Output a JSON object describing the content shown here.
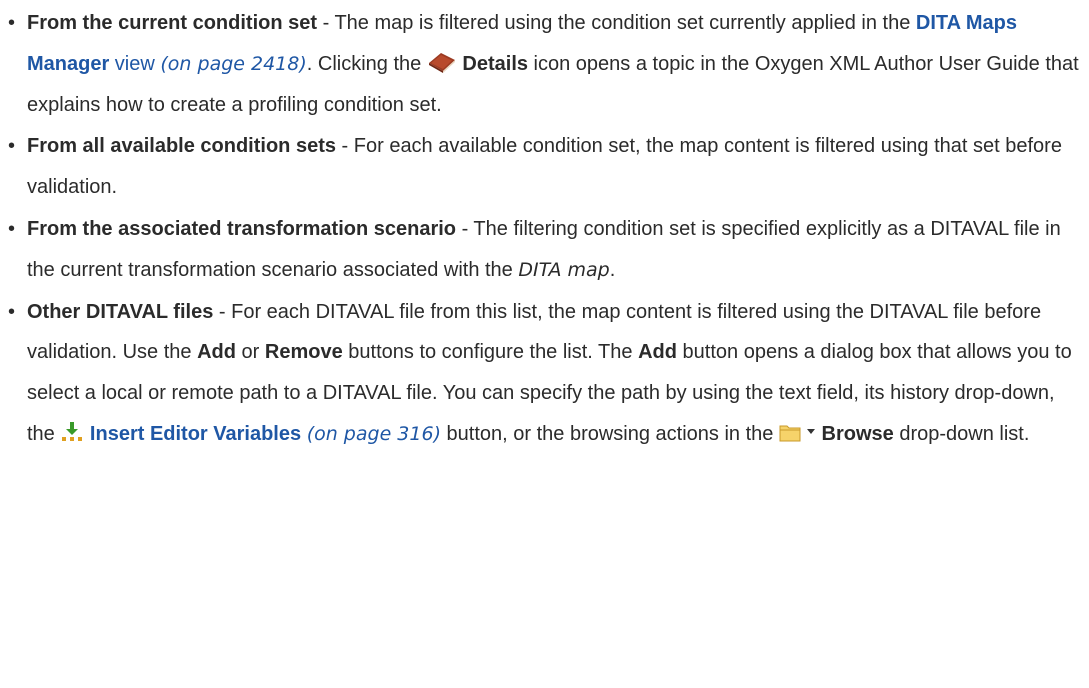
{
  "items": [
    {
      "term": "From the current condition set",
      "t1": " - The map is filtered using the condition set currently applied in the ",
      "link": "DITA Maps Manager",
      "t2": " view",
      "ref": "(on page 2418)",
      "t3": ". Clicking the ",
      "icon": "book-icon",
      "bold": "Details",
      "t4": " icon opens a topic in the Oxygen XML Author User Guide that explains how to create a profiling condition set."
    },
    {
      "term": "From all available condition sets",
      "t1": " - For each available condition set, the map content is filtered using that set before validation."
    },
    {
      "term": "From the associated transformation scenario",
      "t1": " - The filtering condition set is specified explicitly as a DITAVAL file in the current transformation scenario associated with the ",
      "italic": "DITA map",
      "t2": "."
    },
    {
      "term": "Other DITAVAL files",
      "t1": " - For each DITAVAL file from this list, the map content is filtered using the DITAVAL file before validation. Use the ",
      "add": "Add",
      "t2": " or ",
      "remove": "Remove",
      "t3": " buttons to configure the list. The ",
      "add2": "Add",
      "t4": " button opens a dialog box that allows you to select a local or remote path to a DITAVAL file. You can specify the path by using the text field, its history drop-down, the ",
      "icon1": "insert-variables-icon",
      "link": "Insert Editor Variables",
      "ref": "(on page 316)",
      "t5": " button, or the browsing actions in the ",
      "icon2": "folder-icon",
      "icon3": "dropdown-arrow-icon",
      "browse": "Browse",
      "t6": " drop-down list."
    }
  ]
}
